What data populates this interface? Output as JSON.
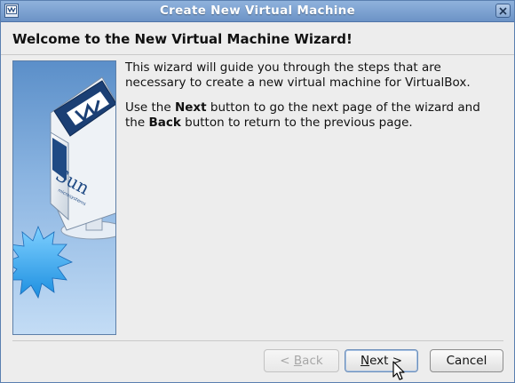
{
  "window": {
    "title": "Create New Virtual Machine"
  },
  "header": {
    "title": "Welcome to the New Virtual Machine Wizard!"
  },
  "body": {
    "para1": "This wizard will guide you through the steps that are necessary to create a new virtual machine for VirtualBox.",
    "para2": {
      "part1": "Use the ",
      "bold1": "Next",
      "part2": " button to go the next page of the wizard and the ",
      "bold2": "Back",
      "part3": " button to return to the previous page."
    }
  },
  "illustration": {
    "logo_text": "Sun",
    "logo_subtext": "microsystems"
  },
  "buttons": {
    "back": {
      "prefix": "< ",
      "mnemonic": "B",
      "rest": "ack",
      "enabled": false
    },
    "next": {
      "mnemonic": "N",
      "rest": "ext",
      "suffix": " >",
      "enabled": true
    },
    "cancel": {
      "label": "Cancel",
      "enabled": true
    }
  },
  "colors": {
    "titlebar": "#7ca1d1",
    "background": "#ededed",
    "image_blue": "#5b8fc9"
  }
}
